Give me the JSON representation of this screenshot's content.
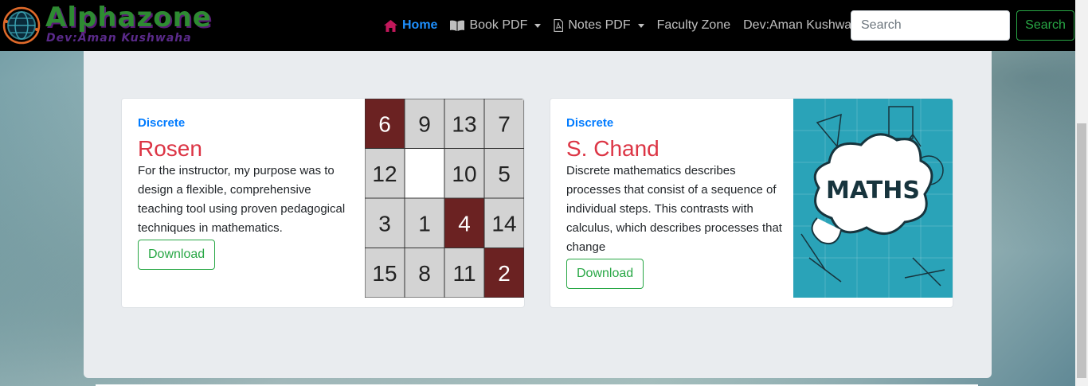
{
  "brand": {
    "title": "Alphazone",
    "subtitle": "Dev:Aman Kushwaha"
  },
  "nav": {
    "home": "Home",
    "book_pdf": "Book PDF",
    "notes_pdf": "Notes PDF",
    "faculty_zone": "Faculty Zone",
    "dev": "Dev:Aman Kushwaha"
  },
  "search": {
    "placeholder": "Search",
    "button_label": "Search"
  },
  "cards": [
    {
      "tag": "Discrete",
      "title": "Rosen",
      "text": "For the instructor, my purpose was to design a flexible, comprehensive teaching tool using proven pedagogical techniques in mathematics.",
      "button": "Download",
      "puzzle": [
        "6",
        "9",
        "13",
        "7",
        "12",
        "",
        "10",
        "5",
        "3",
        "1",
        "4",
        "14",
        "15",
        "8",
        "11",
        "2"
      ]
    },
    {
      "tag": "Discrete",
      "title": "S. Chand",
      "text": "Discrete mathematics describes processes that consist of a sequence of individual steps. This contrasts with calculus, which describes processes that change",
      "button": "Download",
      "image_label": "MATHS"
    }
  ],
  "colors": {
    "accent": "#007bff",
    "title": "#dc3545",
    "success": "#28a745",
    "nav_bg": "#000000"
  }
}
